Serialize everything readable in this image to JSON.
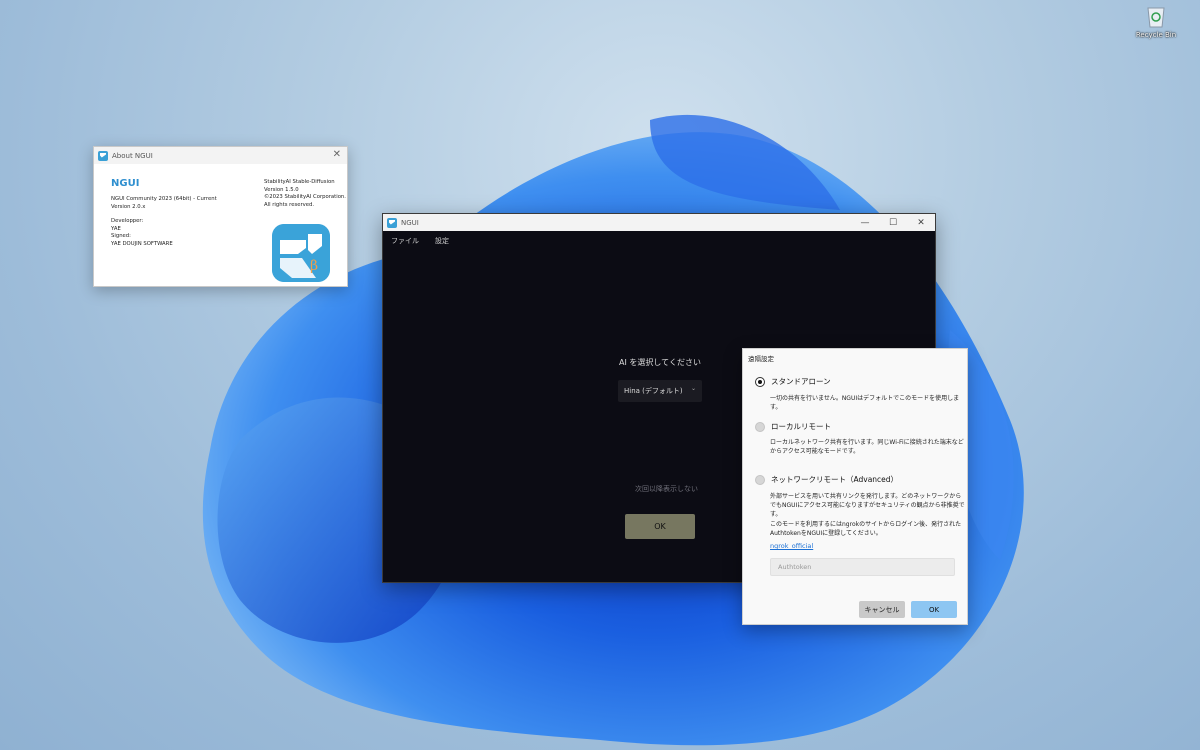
{
  "desktop": {
    "recycle_bin_label": "Recycle Bin"
  },
  "about_window": {
    "title": "About NGUI",
    "brand": "NGUI",
    "edition": "NGUI Community 2023 (64bit) - Current",
    "version": "Version 2.0.x",
    "developer_label": "Developper:",
    "developer": "YAE",
    "signed_label": "Signed:",
    "signer": "YAE DOUJIN SOFTWARE",
    "engine": "StabilityAI Stable-Diffusion",
    "engine_version": "Version 1.5.0",
    "copyright": "©2023 StabilityAI Corporation.",
    "rights": "All rights reserved.",
    "logo_letter": "β"
  },
  "main_window": {
    "title": "NGUI",
    "menu": [
      "ファイル",
      "設定"
    ],
    "prompt": "AI を選択してください",
    "selected_ai": "Hina (デフォルト)",
    "dont_show": "次回以降表示しない",
    "ok_label": "OK"
  },
  "remote_dialog": {
    "title": "遠隔設定",
    "options": [
      {
        "label": "スタンドアローン",
        "desc": "一切の共有を行いません。NGUIはデフォルトでこのモードを使用します。",
        "selected": true
      },
      {
        "label": "ローカルリモート",
        "desc": "ローカルネットワーク共有を行います。同じWi-Fiに接続された端末などからアクセス可能なモードです。",
        "selected": false
      },
      {
        "label": "ネットワークリモート（Advanced）",
        "desc": "外部サービスを用いて共有リンクを発行します。どのネットワークからでもNGUIにアクセス可能になりますがセキュリティの観点から非推奨です。",
        "selected": false
      }
    ],
    "ngrok_note": "このモードを利用するにはngrokのサイトからログイン後、発行されたAuthtokenをNGUIに登録してください。",
    "link_label": "ngrok_official",
    "token_placeholder": "Authtoken",
    "cancel_label": "キャンセル",
    "ok_label": "OK"
  }
}
